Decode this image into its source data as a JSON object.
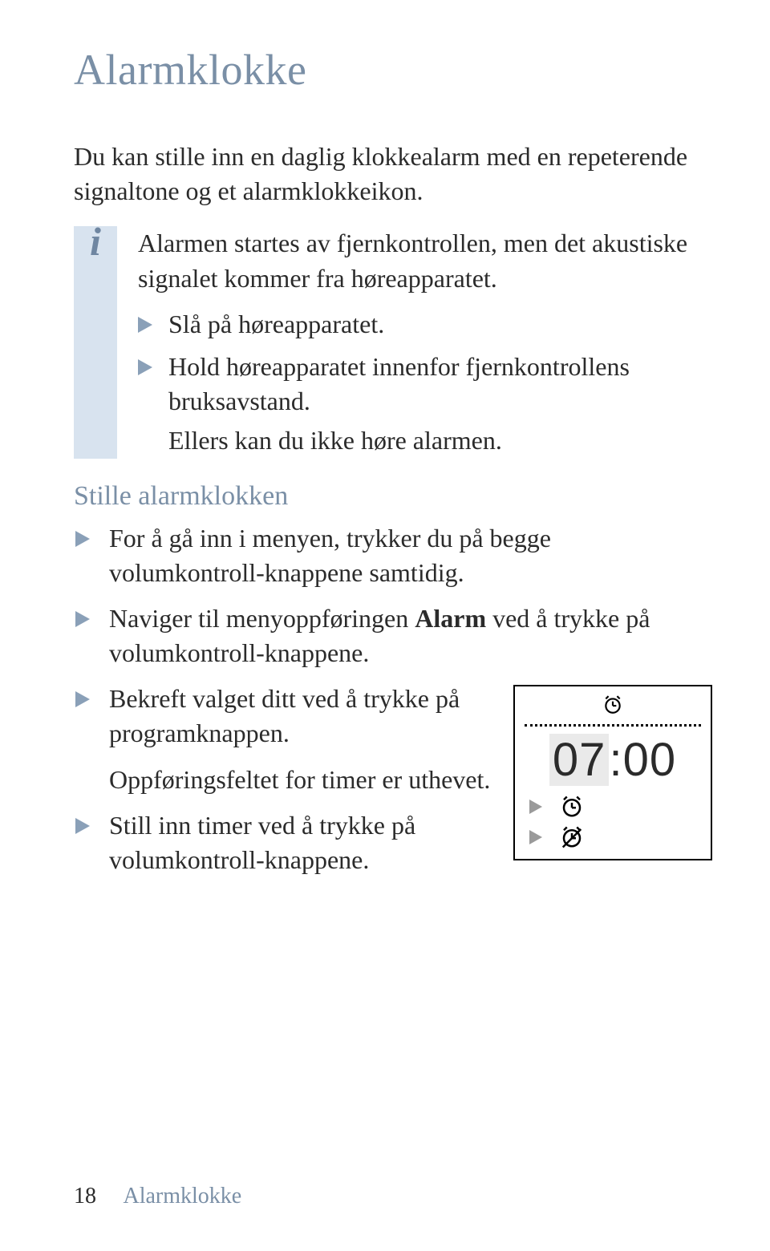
{
  "title": "Alarmklokke",
  "intro": "Du kan stille inn en daglig klokkealarm med en repeterende signaltone og et alarmklokkeikon.",
  "info": {
    "lead": "Alarmen startes av fjernkontrollen, men det akustiske signalet kommer fra høreapparatet.",
    "bullets": [
      "Slå på høreapparatet.",
      "Hold høreapparatet innenfor fjernkontrollens bruksavstand."
    ],
    "trail": "Ellers kan du ikke høre alarmen."
  },
  "subheading": "Stille alarmklokken",
  "steps": {
    "s1": "For å gå inn i menyen, trykker du på begge volumkontroll-knappene samtidig.",
    "s2_pre": "Naviger til menyoppføringen ",
    "s2_bold": "Alarm",
    "s2_post": " ved å trykke på volumkontroll-knappene.",
    "s3": "Bekreft valget ditt ved å trykke på programknappen.",
    "note": "Oppføringsfeltet for timer er uthevet.",
    "s4": "Still inn timer ved å trykke på volumkontroll-knappene."
  },
  "device": {
    "hours": "07",
    "sep": ":",
    "minutes": "00"
  },
  "footer": {
    "page": "18",
    "section": "Alarmklokke"
  }
}
